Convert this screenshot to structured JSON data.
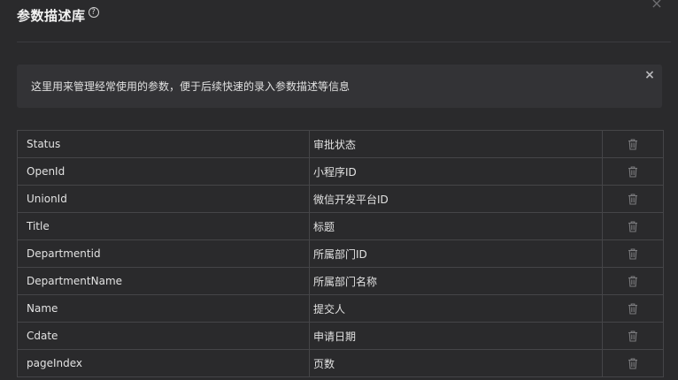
{
  "dialog": {
    "title": "参数描述库",
    "help_glyph": "?",
    "close_glyph": "×"
  },
  "notice": {
    "text": "这里用来管理经常使用的参数，便于后续快速的录入参数描述等信息",
    "close_glyph": "×"
  },
  "table": {
    "rows": [
      {
        "name": "Status",
        "desc": "审批状态"
      },
      {
        "name": "OpenId",
        "desc": "小程序ID"
      },
      {
        "name": "UnionId",
        "desc": "微信开发平台ID"
      },
      {
        "name": "Title",
        "desc": "标题"
      },
      {
        "name": "Departmentid",
        "desc": "所属部门ID"
      },
      {
        "name": "DepartmentName",
        "desc": "所属部门名称"
      },
      {
        "name": "Name",
        "desc": "提交人"
      },
      {
        "name": "Cdate",
        "desc": "申请日期"
      },
      {
        "name": "pageIndex",
        "desc": "页数"
      }
    ],
    "delete_icon": "trash-icon"
  },
  "colors": {
    "background": "#2a2a2c",
    "notice_bg": "#333336",
    "border": "#454548",
    "icon": "#7a7a7d"
  }
}
